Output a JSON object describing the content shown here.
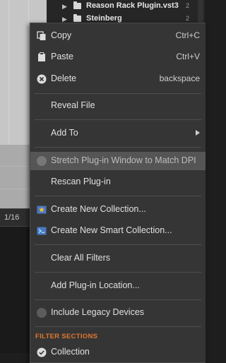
{
  "background": {
    "zoom_label": "1/16",
    "browser_rows": [
      {
        "name": "Reason Rack Plugin.vst3",
        "count": "2"
      },
      {
        "name": "Steinberg",
        "count": "2"
      }
    ]
  },
  "menu": {
    "copy": {
      "label": "Copy",
      "shortcut": "Ctrl+C"
    },
    "paste": {
      "label": "Paste",
      "shortcut": "Ctrl+V"
    },
    "delete": {
      "label": "Delete",
      "shortcut": "backspace"
    },
    "reveal_file": {
      "label": "Reveal File"
    },
    "add_to": {
      "label": "Add To"
    },
    "stretch": {
      "label": "Stretch Plug-in Window to Match DPI"
    },
    "rescan": {
      "label": "Rescan Plug-in"
    },
    "new_collection": {
      "label": "Create New Collection..."
    },
    "new_smart_collection": {
      "label": "Create New Smart Collection..."
    },
    "clear_filters": {
      "label": "Clear All Filters"
    },
    "add_location": {
      "label": "Add Plug-in Location..."
    },
    "legacy": {
      "label": "Include Legacy Devices"
    },
    "filter_sections_title": "FILTER SECTIONS",
    "collection": {
      "label": "Collection"
    }
  },
  "colors": {
    "menu_bg": "#353535",
    "accent_orange": "#e0782e",
    "highlight": "#555555"
  }
}
